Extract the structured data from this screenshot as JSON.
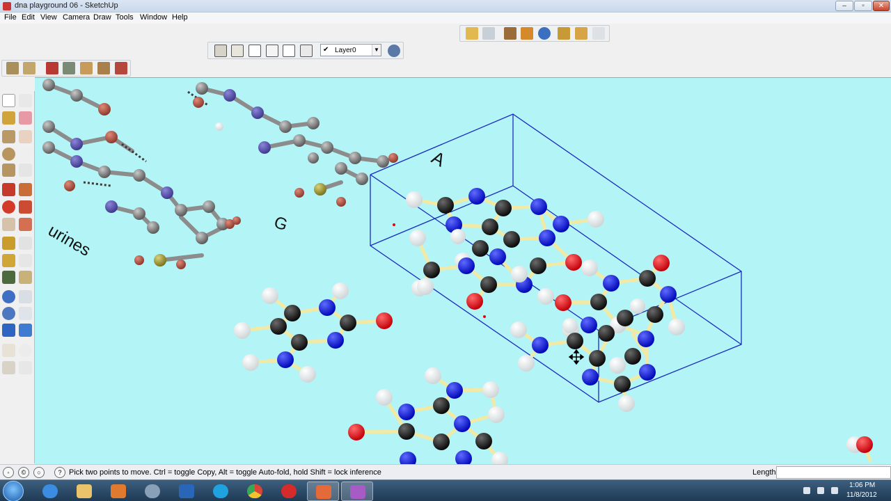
{
  "window": {
    "title": "dna playground 06 - SketchUp",
    "controls": [
      "minimize",
      "maximize",
      "close"
    ]
  },
  "menu": [
    "File",
    "Edit",
    "View",
    "Camera",
    "Draw",
    "Tools",
    "Window",
    "Help"
  ],
  "toolbar": {
    "views_icons": [
      "iso-view-icon",
      "top-view-icon",
      "front-view-icon",
      "right-view-icon",
      "back-view-icon",
      "left-view-icon"
    ],
    "layer": {
      "checked": "✔",
      "selected": "Layer0"
    },
    "top_right_icons": [
      "get-models-icon",
      "share-model-icon",
      "place-model-icon",
      "add-location-icon",
      "toggle-terrain-icon",
      "preview-earth-icon",
      "component-icon",
      "share-component-icon",
      "extension-icon"
    ],
    "left_icons": [
      "section-plane-icon",
      "display-section-icon",
      "sandbox-from-contours-icon",
      "sandbox-from-scratch-icon",
      "smoove-icon",
      "stamp-icon",
      "drape-icon",
      "add-detail-icon"
    ]
  },
  "palette": {
    "tools": [
      "select-icon",
      "make-component-icon",
      "paint-bucket-icon",
      "eraser-icon",
      "rectangle-icon",
      "line-icon",
      "circle-icon",
      "arc-icon",
      "polygon-icon",
      "freehand-icon",
      "move-icon",
      "push-pull-icon",
      "rotate-icon",
      "follow-me-icon",
      "scale-icon",
      "offset-icon",
      "tape-measure-icon",
      "dimension-icon",
      "protractor-icon",
      "text-icon",
      "axes-icon",
      "3d-text-icon",
      "orbit-icon",
      "pan-icon",
      "zoom-icon",
      "zoom-window-icon",
      "zoom-extents-icon",
      "previous-view-icon",
      "position-camera-icon",
      "look-around-icon",
      "walk-icon",
      "section-icon"
    ]
  },
  "scene": {
    "labels": {
      "a": "A",
      "g": "G",
      "purines": "urines"
    },
    "colors": {
      "background": "#b3f5f7",
      "carbon": "#1a1a1a",
      "nitrogen": "#0b12e8",
      "oxygen": "#e8000f",
      "hydrogen": "#ffffff",
      "bond": "#f1e9a6",
      "box": "#1a2cbf"
    }
  },
  "status": {
    "message": "Pick two points to move.  Ctrl = toggle Copy, Alt = toggle Auto-fold, hold Shift = lock inference",
    "length_label": "Length",
    "length_value": ""
  },
  "taskbar": {
    "apps": [
      "start-button",
      "internet-explorer-icon",
      "file-explorer-icon",
      "media-player-icon",
      "hp-icon",
      "task-icon",
      "skype-icon",
      "chrome-icon",
      "opera-icon",
      "sketchup-icon",
      "movie-maker-icon"
    ],
    "time": "1:06 PM",
    "date": "11/8/2012"
  }
}
